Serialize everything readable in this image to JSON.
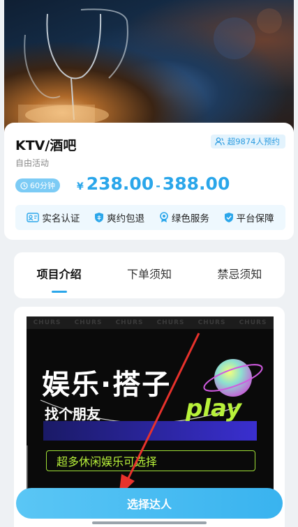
{
  "product": {
    "title": "KTV/酒吧",
    "subtitle": "自由活动",
    "booked_label": "超9874人预约",
    "duration_label": "60分钟",
    "currency": "¥",
    "price_min": "238.00",
    "price_sep": "-",
    "price_max": "388.00"
  },
  "guarantees": [
    {
      "label": "实名认证",
      "icon": "id-card-icon"
    },
    {
      "label": "爽约包退",
      "icon": "shield-icon"
    },
    {
      "label": "绿色服务",
      "icon": "award-icon"
    },
    {
      "label": "平台保障",
      "icon": "shield-check-icon"
    }
  ],
  "tabs": [
    {
      "label": "项目介绍",
      "active": true
    },
    {
      "label": "下单须知",
      "active": false
    },
    {
      "label": "禁忌须知",
      "active": false
    }
  ],
  "poster": {
    "strip_text": [
      "CHURS",
      "CHURS",
      "CHURS",
      "CHURS",
      "CHURS",
      "CHURS"
    ],
    "title": "娱乐·搭子",
    "sub": "找个朋友",
    "play": "play",
    "caption": "超多休闲娱乐可选择"
  },
  "cta": {
    "label": "选择达人"
  },
  "colors": {
    "accent": "#2aa6ea",
    "badge_bg": "#7ccbf5",
    "annotation": "#e8322c"
  }
}
